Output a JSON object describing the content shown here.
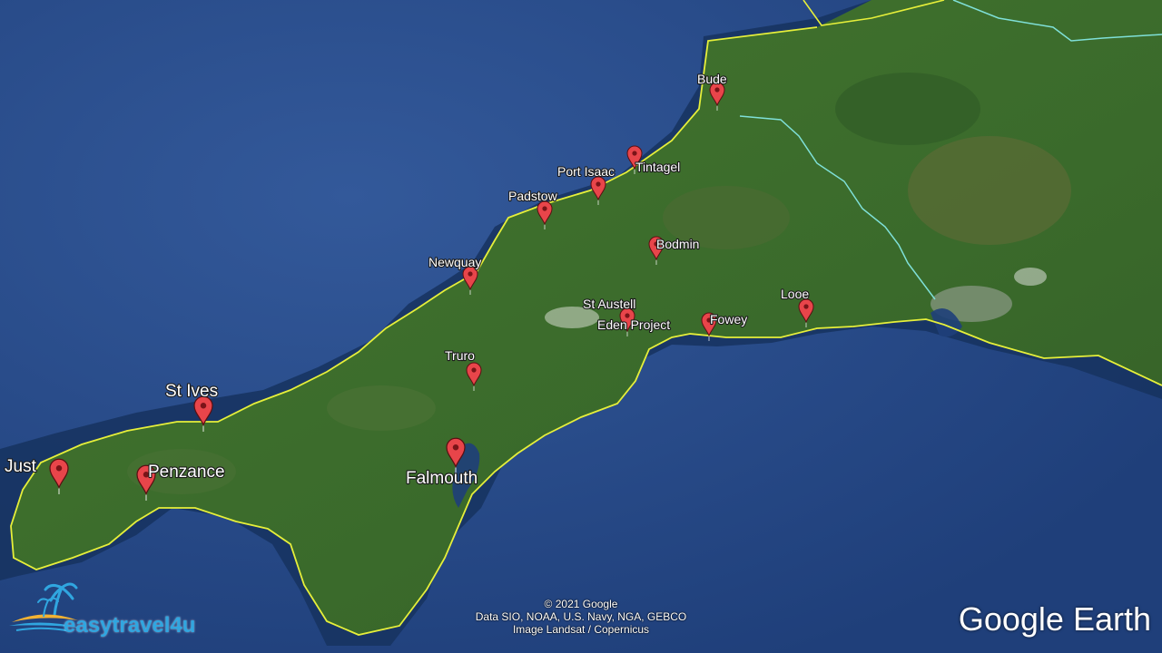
{
  "map": {
    "places": [
      {
        "name": "Bude",
        "size": "small"
      },
      {
        "name": "Tintagel",
        "size": "small"
      },
      {
        "name": "Port Isaac",
        "size": "small"
      },
      {
        "name": "Padstow",
        "size": "small"
      },
      {
        "name": "Bodmin",
        "size": "small"
      },
      {
        "name": "Newquay",
        "size": "small"
      },
      {
        "name": "St Austell",
        "size": "small"
      },
      {
        "name": "Eden Project",
        "size": "small"
      },
      {
        "name": "Fowey",
        "size": "small"
      },
      {
        "name": "Looe",
        "size": "small"
      },
      {
        "name": "Truro",
        "size": "small"
      },
      {
        "name": "St Ives",
        "size": "large"
      },
      {
        "name": "Just",
        "size": "large"
      },
      {
        "name": "Penzance",
        "size": "large"
      },
      {
        "name": "Falmouth",
        "size": "large"
      }
    ],
    "colors": {
      "sea": "#2a4f8c",
      "land": "#3e6b2e",
      "coastline": "#e6ef3a",
      "border": "#7fe0d8",
      "marker": "#e8454a"
    }
  },
  "attribution": {
    "line1": "© 2021 Google",
    "line2": "Data SIO, NOAA, U.S. Navy, NGA, GEBCO",
    "line3": "Image Landsat / Copernicus"
  },
  "logos": {
    "google_earth": "Google Earth",
    "brand": "easytravel4u"
  }
}
